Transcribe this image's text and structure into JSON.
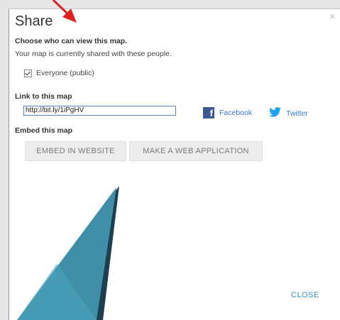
{
  "dialog": {
    "title": "Share",
    "close_glyph": "×",
    "view_heading": "Choose who can view this map.",
    "view_text": "Your map is currently shared with these people.",
    "everyone_label": "Everyone (public)",
    "everyone_checked": true,
    "link_heading": "Link to this map",
    "link_value": "http://bit.ly/1iPgHV",
    "facebook_label": "Facebook",
    "twitter_label": "Twitter",
    "embed_heading": "Embed this map",
    "embed_button": "EMBED IN WEBSITE",
    "webapp_button": "MAKE A WEB APPLICATION",
    "close_button": "CLOSE"
  },
  "icons": {
    "facebook": "facebook-icon",
    "twitter": "twitter-icon",
    "close": "close-icon",
    "checkbox": "checkbox-icon"
  },
  "colors": {
    "facebook": "#3b5998",
    "twitter": "#1da1f2",
    "link": "#3a78c8",
    "close_button": "#3a8ec2",
    "annotation_arrow": "#e02020",
    "callout": "#3d8fa8"
  }
}
